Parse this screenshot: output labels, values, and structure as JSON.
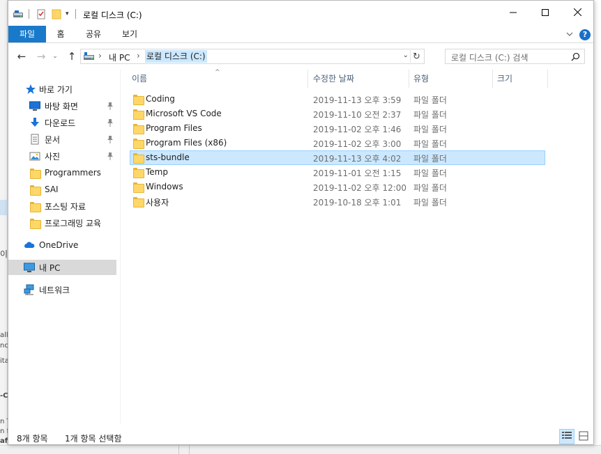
{
  "window": {
    "title": "로컬 디스크 (C:)"
  },
  "ribbon": {
    "tabs": [
      "파일",
      "홈",
      "공유",
      "보기"
    ],
    "help_label": "?"
  },
  "address": {
    "breadcrumbs": [
      "내 PC",
      "로컬 디스크 (C:)"
    ],
    "search_placeholder": "로컬 디스크 (C:) 검색"
  },
  "nav": {
    "quick_access": "바로 가기",
    "pinned": [
      "바탕 화면",
      "다운로드",
      "문서",
      "사진"
    ],
    "folders": [
      "Programmers",
      "SAI",
      "포스팅 자료",
      "프로그래밍 교육"
    ],
    "onedrive": "OneDrive",
    "this_pc": "내 PC",
    "network": "네트워크"
  },
  "columns": {
    "name": "이름",
    "modified": "수정한 날짜",
    "type": "유형",
    "size": "크기"
  },
  "files": [
    {
      "name": "Coding",
      "date": "2019-11-13 오후 3:59",
      "type": "파일 폴더"
    },
    {
      "name": "Microsoft VS Code",
      "date": "2019-11-10 오전 2:37",
      "type": "파일 폴더"
    },
    {
      "name": "Program Files",
      "date": "2019-11-02 오후 1:46",
      "type": "파일 폴더"
    },
    {
      "name": "Program Files (x86)",
      "date": "2019-11-02 오후 3:00",
      "type": "파일 폴더"
    },
    {
      "name": "sts-bundle",
      "date": "2019-11-13 오후 4:02",
      "type": "파일 폴더"
    },
    {
      "name": "Temp",
      "date": "2019-11-01 오전 1:15",
      "type": "파일 폴더"
    },
    {
      "name": "Windows",
      "date": "2019-11-02 오후 12:00",
      "type": "파일 폴더"
    },
    {
      "name": "사용자",
      "date": "2019-10-18 오후 1:01",
      "type": "파일 폴더"
    }
  ],
  "selected_file": "sts-bundle",
  "status": {
    "item_count": "8개 항목",
    "selection": "1개 항목 선택함"
  },
  "background_fragments": [
    "이",
    "all",
    "nc",
    "ita",
    "-C",
    "n T",
    "n f",
    "afe"
  ],
  "colors": {
    "accent": "#1979ca",
    "selection": "#cce8ff",
    "folder": "#ffd768"
  }
}
